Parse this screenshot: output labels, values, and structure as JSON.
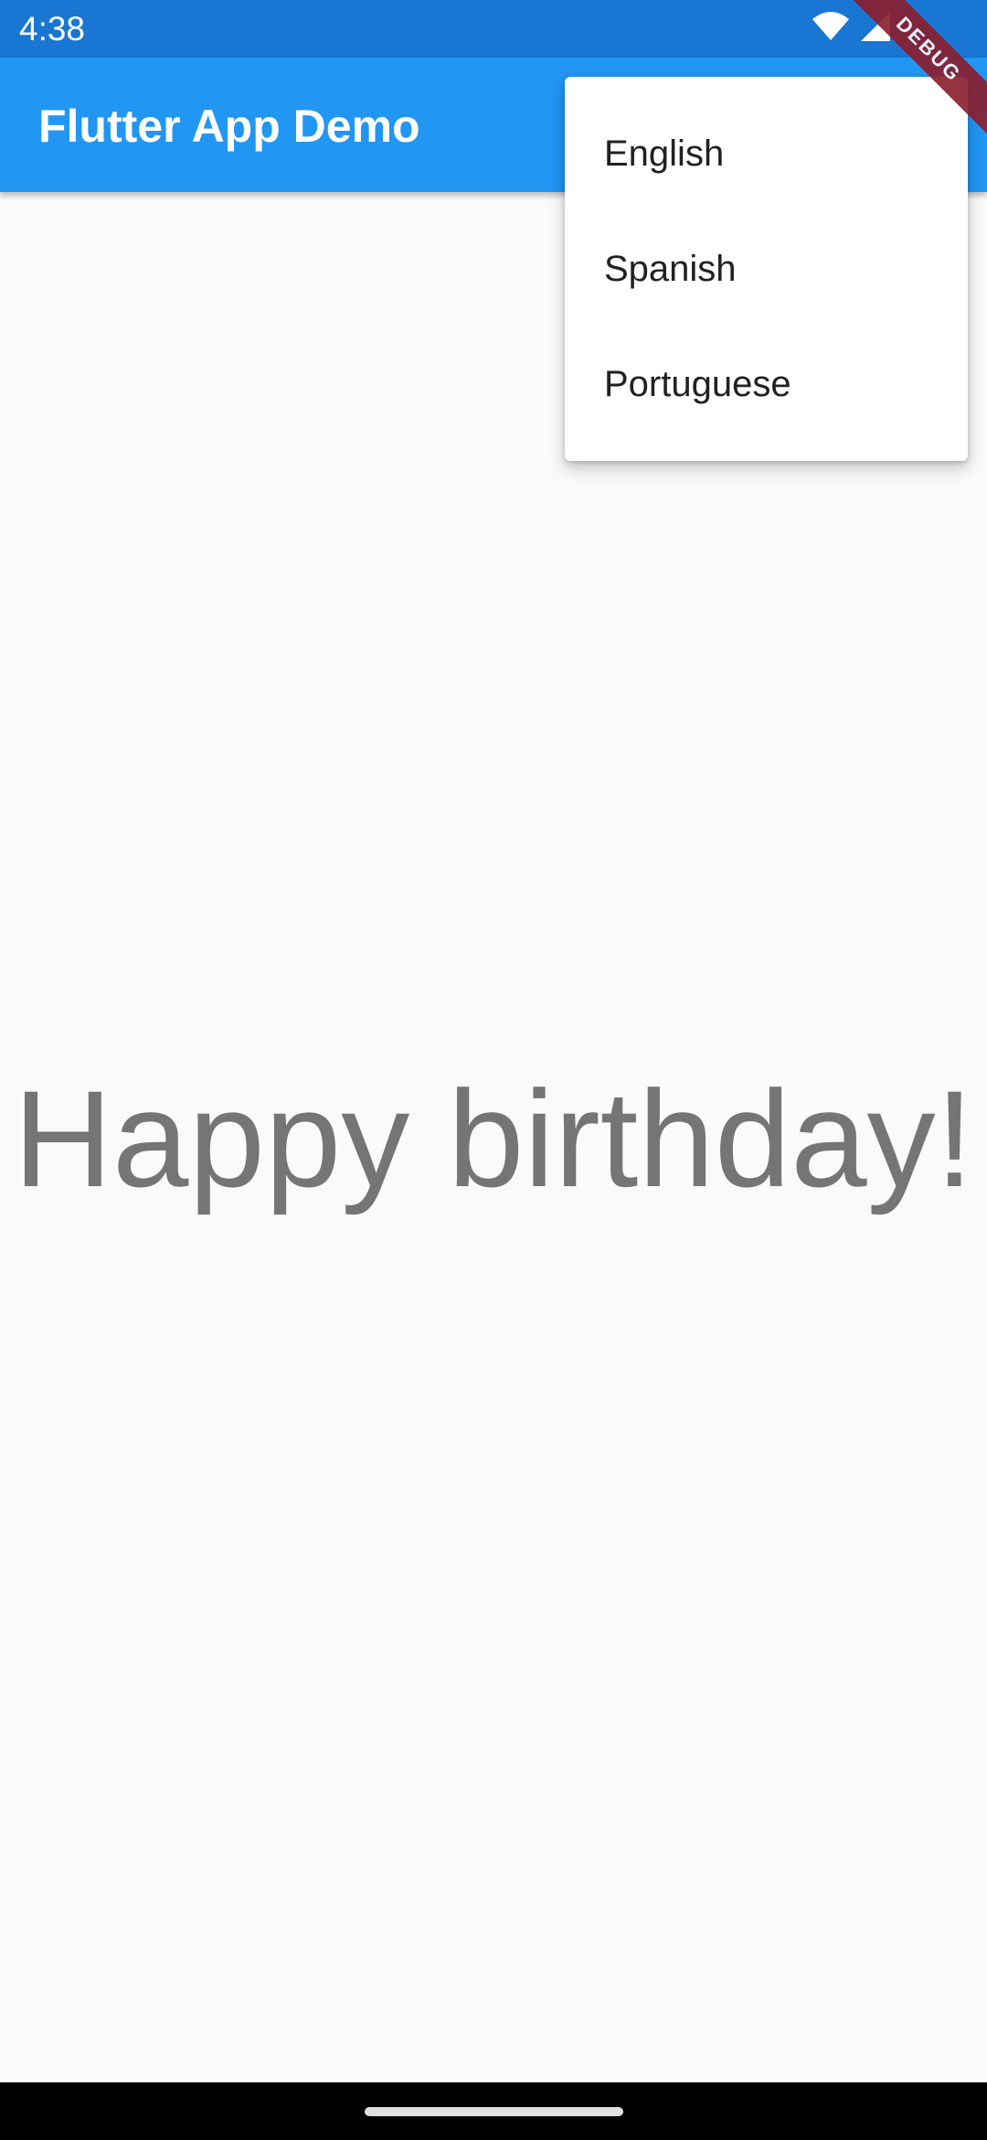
{
  "status_bar": {
    "time": "4:38",
    "icons": [
      "wifi-icon",
      "signal-icon"
    ]
  },
  "app_bar": {
    "title": "Flutter App Demo"
  },
  "main": {
    "message": "Happy birthday!"
  },
  "menu": {
    "items": [
      {
        "label": "English"
      },
      {
        "label": "Spanish"
      },
      {
        "label": "Portuguese"
      }
    ]
  },
  "debug_banner": {
    "label": "DEBUG"
  },
  "colors": {
    "status_bar": "#1976d2",
    "app_bar": "#2196f3",
    "background": "#fafafa",
    "message_text": "#757575",
    "debug_banner": "#8b1d2c"
  }
}
